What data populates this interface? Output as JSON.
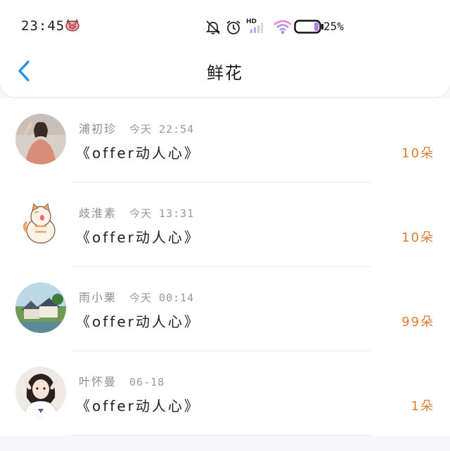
{
  "status_bar": {
    "time": "23:45",
    "battery_percent": "25%",
    "network_label": "HD",
    "icons": [
      "pig-icon",
      "mute-bell-icon",
      "alarm-icon",
      "signal-icon",
      "wifi-icon",
      "battery-icon"
    ]
  },
  "header": {
    "back_icon": "chevron-left-icon",
    "title": "鲜花"
  },
  "colors": {
    "accent": "#2a8df0",
    "count": "#e07b2e"
  },
  "gifts": [
    {
      "sender": "浦初珍",
      "time": "今天 22:54",
      "gift": "《offer动人心》",
      "count": "10朵"
    },
    {
      "sender": "歧淮素",
      "time": "今天 13:31",
      "gift": "《offer动人心》",
      "count": "10朵"
    },
    {
      "sender": "雨小栗",
      "time": "今天 00:14",
      "gift": "《offer动人心》",
      "count": "99朵"
    },
    {
      "sender": "叶怀曼",
      "time": "06-18",
      "gift": "《offer动人心》",
      "count": "1朵"
    }
  ]
}
